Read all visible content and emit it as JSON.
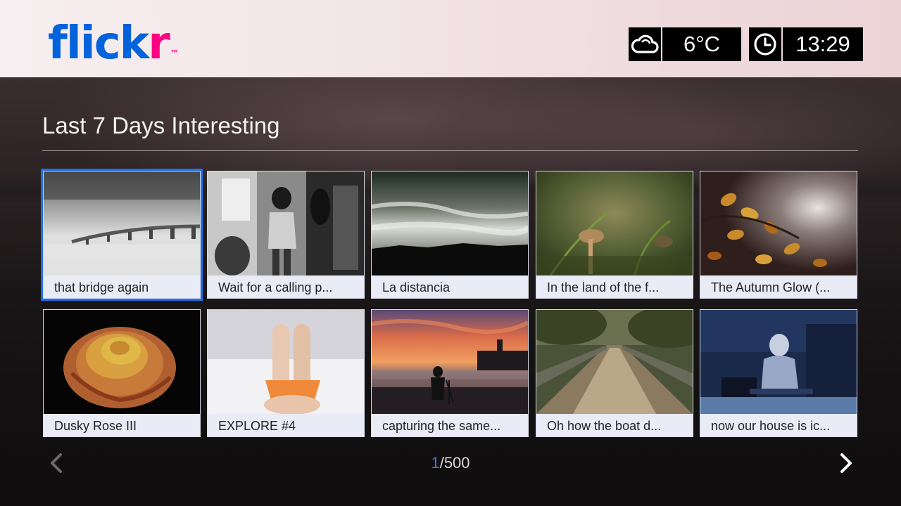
{
  "header": {
    "logo_part1": "flickr",
    "logo_part2": "",
    "trademark": "™",
    "weather_icon": "cloud-icon",
    "temperature": "6°C",
    "clock_icon": "clock-icon",
    "time": "13:29"
  },
  "section": {
    "title": "Last 7 Days Interesting"
  },
  "photos": [
    {
      "caption": "that bridge again",
      "selected": true
    },
    {
      "caption": "Wait for a calling p..."
    },
    {
      "caption": "La distancia"
    },
    {
      "caption": "In the land of the f..."
    },
    {
      "caption": "The Autumn Glow (..."
    },
    {
      "caption": "Dusky Rose III"
    },
    {
      "caption": "EXPLORE #4"
    },
    {
      "caption": "capturing the same..."
    },
    {
      "caption": "Oh how the boat d..."
    },
    {
      "caption": "now our house is ic..."
    }
  ],
  "pager": {
    "current": "1",
    "total": "/500"
  },
  "colors": {
    "accent": "#1e6fe8",
    "flickr_blue": "#0063dc",
    "flickr_pink": "#ff0084"
  }
}
